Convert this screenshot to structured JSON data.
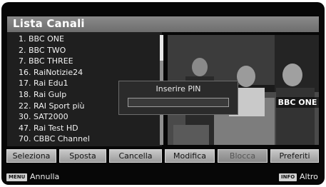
{
  "header": {
    "title": "Lista Canali"
  },
  "channels": [
    "1. BBC ONE",
    "2. BBC TWO",
    "7. BBC THREE",
    "16. RaiNotizie24",
    "17. Rai Edu1",
    "18. Rai Gulp",
    "22. RAI Sport più",
    "30. SAT2000",
    "47. Rai Test HD",
    "70. CBBC Channel"
  ],
  "preview": {
    "channel_label": "BBC ONE"
  },
  "pin_dialog": {
    "title": "Inserire PIN",
    "value": ""
  },
  "buttons": [
    {
      "label": "Seleziona",
      "enabled": true
    },
    {
      "label": "Sposta",
      "enabled": true
    },
    {
      "label": "Cancella",
      "enabled": true
    },
    {
      "label": "Modifica",
      "enabled": true
    },
    {
      "label": "Blocca",
      "enabled": false
    },
    {
      "label": "Preferiti",
      "enabled": true
    }
  ],
  "footer": {
    "menu_key": "MENU",
    "menu_label": "Annulla",
    "info_key": "INFO",
    "info_label": "Altro"
  },
  "colors": {
    "background": "#070707",
    "header": "#7a7a7a",
    "list_bg": "#1f1f1f"
  }
}
